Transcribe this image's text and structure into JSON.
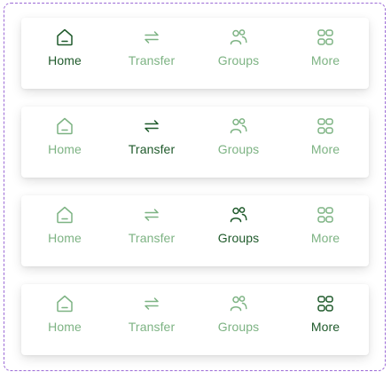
{
  "colors": {
    "active": "#1f5a2b",
    "inactive": "#7db383",
    "frame": "#9b6ad6"
  },
  "tab_bars": [
    {
      "active_tab": "home",
      "tabs": [
        {
          "id": "home",
          "label": "Home",
          "icon": "home-icon"
        },
        {
          "id": "transfer",
          "label": "Transfer",
          "icon": "transfer-icon"
        },
        {
          "id": "groups",
          "label": "Groups",
          "icon": "groups-icon"
        },
        {
          "id": "more",
          "label": "More",
          "icon": "grid-icon"
        }
      ]
    },
    {
      "active_tab": "transfer",
      "tabs": [
        {
          "id": "home",
          "label": "Home",
          "icon": "home-icon"
        },
        {
          "id": "transfer",
          "label": "Transfer",
          "icon": "transfer-icon"
        },
        {
          "id": "groups",
          "label": "Groups",
          "icon": "groups-icon"
        },
        {
          "id": "more",
          "label": "More",
          "icon": "grid-icon"
        }
      ]
    },
    {
      "active_tab": "groups",
      "tabs": [
        {
          "id": "home",
          "label": "Home",
          "icon": "home-icon"
        },
        {
          "id": "transfer",
          "label": "Transfer",
          "icon": "transfer-icon"
        },
        {
          "id": "groups",
          "label": "Groups",
          "icon": "groups-icon"
        },
        {
          "id": "more",
          "label": "More",
          "icon": "grid-icon"
        }
      ]
    },
    {
      "active_tab": "more",
      "tabs": [
        {
          "id": "home",
          "label": "Home",
          "icon": "home-icon"
        },
        {
          "id": "transfer",
          "label": "Transfer",
          "icon": "transfer-icon"
        },
        {
          "id": "groups",
          "label": "Groups",
          "icon": "groups-icon"
        },
        {
          "id": "more",
          "label": "More",
          "icon": "grid-icon"
        }
      ]
    }
  ]
}
